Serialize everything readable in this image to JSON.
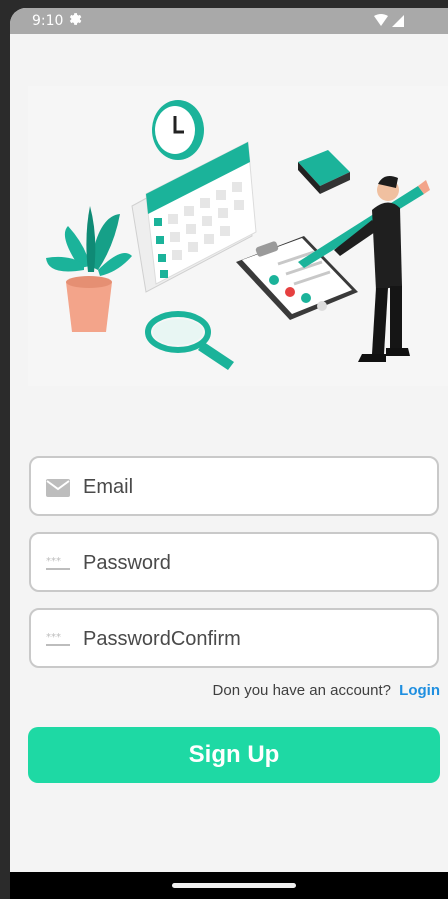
{
  "statusbar": {
    "time": "9:10",
    "icons": [
      "gear-icon",
      "wifi-icon",
      "signal-icon"
    ]
  },
  "illustration": {
    "icon": "schedule-illustration",
    "colors": {
      "teal": "#1bb39a",
      "pot": "#f3a48a",
      "suit": "#1f1f1f"
    }
  },
  "form": {
    "email": {
      "placeholder": "Email",
      "value": "",
      "icon": "mail-icon"
    },
    "password": {
      "placeholder": "Password",
      "value": "",
      "icon": "password-dots-icon"
    },
    "password_confirm": {
      "placeholder": "PasswordConfirm",
      "value": "",
      "icon": "password-dots-icon"
    }
  },
  "account": {
    "prompt": "Don you have an account?",
    "login_label": "Login"
  },
  "signup": {
    "label": "Sign Up",
    "color": "#1ed9a4"
  },
  "theme": {
    "link_color": "#1f8fe0",
    "background": "#f4f4f4"
  }
}
